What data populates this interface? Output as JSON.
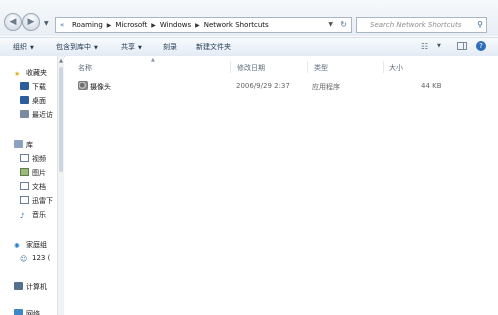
{
  "address_bar": {
    "breadcrumbs": [
      "Roaming",
      "Microsoft",
      "Windows",
      "Network Shortcuts"
    ],
    "search_placeholder": "Search Network Shortcuts"
  },
  "toolbar": {
    "organize": "组织",
    "include_in_library": "包含到库中",
    "share": "共享",
    "burn": "刻录",
    "new_folder": "新建文件夹"
  },
  "nav_pane": {
    "favorites_header": "收藏夹",
    "favorites": [
      "下载",
      "桌面",
      "最近访"
    ],
    "libraries_header": "库",
    "libraries": [
      "视频",
      "图片",
      "文档",
      "迅雷下",
      "音乐"
    ],
    "homegroup_header": "家庭组",
    "homegroup_user": "123 (",
    "computer": "计算机",
    "network": "网络"
  },
  "columns": {
    "name": "名称",
    "date_modified": "修改日期",
    "type": "类型",
    "size": "大小"
  },
  "files": [
    {
      "name": "摄像头",
      "date_modified": "2006/9/29 2:37",
      "type": "应用程序",
      "size": "44 KB",
      "icon": "webcam-app-icon"
    }
  ],
  "colors": {
    "toolbar_bg": "#e3ebf4",
    "accent_blue": "#2f6fb8"
  }
}
